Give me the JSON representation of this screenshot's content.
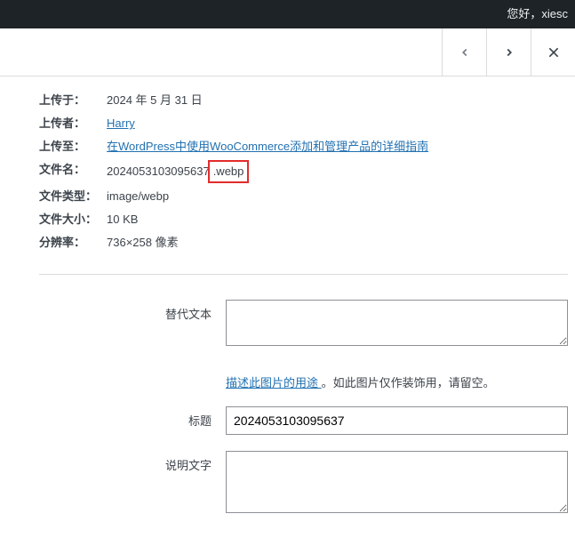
{
  "topbar": {
    "greeting": "您好，xiesc"
  },
  "meta": {
    "uploadedOn": {
      "label": "上传于：",
      "value": "2024 年 5 月 31 日"
    },
    "uploadedBy": {
      "label": "上传者：",
      "value": "Harry"
    },
    "uploadedTo": {
      "label": "上传至：",
      "value": "在WordPress中使用WooCommerce添加和管理产品的详细指南"
    },
    "filename": {
      "label": "文件名：",
      "value_base": "2024053103095637",
      "value_ext": ".webp"
    },
    "filetype": {
      "label": "文件类型：",
      "value": "image/webp"
    },
    "filesize": {
      "label": "文件大小：",
      "value": "10 KB"
    },
    "dimensions": {
      "label": "分辨率：",
      "value": "736×258 像素"
    }
  },
  "form": {
    "altText": {
      "label": "替代文本",
      "value": ""
    },
    "altHelp": {
      "link": "描述此图片的用途 ",
      "rest": "。如此图片仅作装饰用，请留空。"
    },
    "title": {
      "label": "标题",
      "value": "2024053103095637"
    },
    "caption": {
      "label": "说明文字",
      "value": ""
    }
  }
}
